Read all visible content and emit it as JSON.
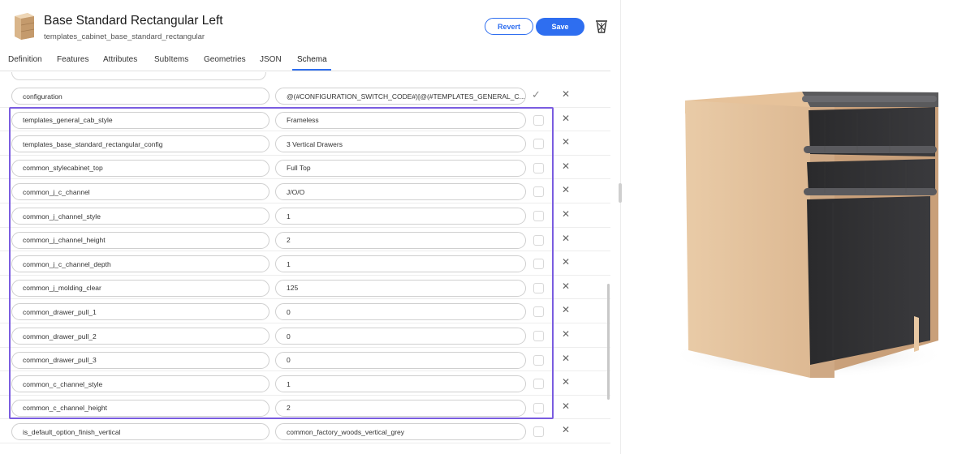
{
  "header": {
    "title": "Base Standard Rectangular Left",
    "subtitle": "templates_cabinet_base_standard_rectangular",
    "revert_label": "Revert",
    "save_label": "Save"
  },
  "tabs": [
    {
      "label": "Definition",
      "active": false
    },
    {
      "label": "Features",
      "active": false
    },
    {
      "label": "Attributes",
      "active": false
    },
    {
      "label": "SubItems",
      "active": false
    },
    {
      "label": "Geometries",
      "active": false
    },
    {
      "label": "JSON",
      "active": false
    },
    {
      "label": "Schema",
      "active": true
    }
  ],
  "rows": [
    {
      "name": "configuration",
      "value": "@(#CONFIGURATION_SWITCH_CODE#)[@(#TEMPLATES_GENERAL_C...",
      "checked": true
    },
    {
      "name": "templates_general_cab_style",
      "value": "Frameless",
      "checked": false
    },
    {
      "name": "templates_base_standard_rectangular_config",
      "value": "3 Vertical Drawers",
      "checked": false
    },
    {
      "name": "common_stylecabinet_top",
      "value": "Full Top",
      "checked": false
    },
    {
      "name": "common_j_c_channel",
      "value": "J/O/O",
      "checked": false
    },
    {
      "name": "common_j_channel_style",
      "value": "1",
      "checked": false
    },
    {
      "name": "common_j_channel_height",
      "value": "2",
      "checked": false
    },
    {
      "name": "common_j_c_channel_depth",
      "value": "1",
      "checked": false
    },
    {
      "name": "common_j_molding_clear",
      "value": "125",
      "checked": false
    },
    {
      "name": "common_drawer_pull_1",
      "value": "0",
      "checked": false
    },
    {
      "name": "common_drawer_pull_2",
      "value": "0",
      "checked": false
    },
    {
      "name": "common_drawer_pull_3",
      "value": "0",
      "checked": false
    },
    {
      "name": "common_c_channel_style",
      "value": "1",
      "checked": false
    },
    {
      "name": "common_c_channel_height",
      "value": "2",
      "checked": false
    },
    {
      "name": "is_default_option_finish_vertical",
      "value": "common_factory_woods_vertical_grey",
      "checked": false
    }
  ],
  "icons": {
    "thumbnail": "cabinet-thumbnail-icon",
    "delete": "trash-icon",
    "remove_row": "close-icon",
    "checkmark": "checkmark-icon"
  },
  "colors": {
    "accent": "#2e6ef0",
    "highlight": "#7a5ce0",
    "cabinet_wood": "#e8c8a3",
    "drawer_front": "#2c2c2e"
  }
}
